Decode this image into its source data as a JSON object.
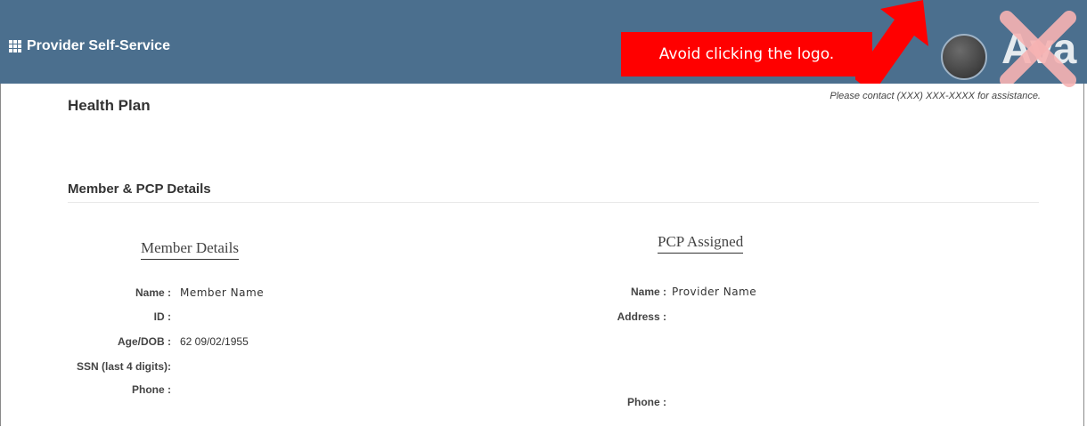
{
  "header": {
    "app_title": "Provider Self-Service",
    "icon": "grid-icon",
    "logo_text": "Ava",
    "banner_text": "Avoid clicking the logo.",
    "colors": {
      "topbar": "#4b6f8e",
      "banner": "#ff0000",
      "cross": "#f7b3b3"
    }
  },
  "page": {
    "assistance": "Please contact (XXX) XXX-XXXX for assistance.",
    "title": "Health Plan",
    "section_title": "Member & PCP Details"
  },
  "member": {
    "heading": "Member Details",
    "labels": {
      "name": "Name :",
      "id": "ID :",
      "age_dob": "Age/DOB :",
      "ssn": "SSN (last 4 digits):",
      "phone": "Phone :"
    },
    "values": {
      "name": "Member Name",
      "age_dob": "62 09/02/1955"
    }
  },
  "pcp": {
    "heading": "PCP Assigned",
    "labels": {
      "name": "Name :",
      "address": "Address :",
      "phone": "Phone :"
    },
    "values": {
      "name": "Provider Name"
    }
  }
}
